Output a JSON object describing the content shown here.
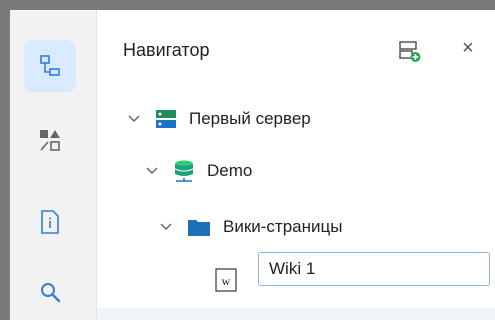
{
  "activity_bar": {
    "items": [
      {
        "icon": "navigator-tree-icon",
        "active": true
      },
      {
        "icon": "shapes-icon",
        "active": false
      },
      {
        "icon": "document-info-icon",
        "active": false
      },
      {
        "icon": "search-icon",
        "active": false
      }
    ]
  },
  "navigator": {
    "title": "Навигатор",
    "add_server_icon": "add-server-icon",
    "close_label": "×"
  },
  "tree": [
    {
      "label": "Первый сервер",
      "icon": "server-icon",
      "expanded": true
    },
    {
      "label": "Demo",
      "icon": "database-icon",
      "expanded": true
    },
    {
      "label": "Вики-страницы",
      "icon": "folder-icon",
      "expanded": true
    },
    {
      "label": "",
      "icon": "wiki-page-icon",
      "editing": true,
      "input_value": "Wiki 1"
    }
  ],
  "colors": {
    "accent": "#2f7fd8",
    "active_bg": "#d8eaff",
    "server_green": "#2ecc71",
    "db_teal": "#1aa37a",
    "folder_blue": "#1f6fb8"
  }
}
